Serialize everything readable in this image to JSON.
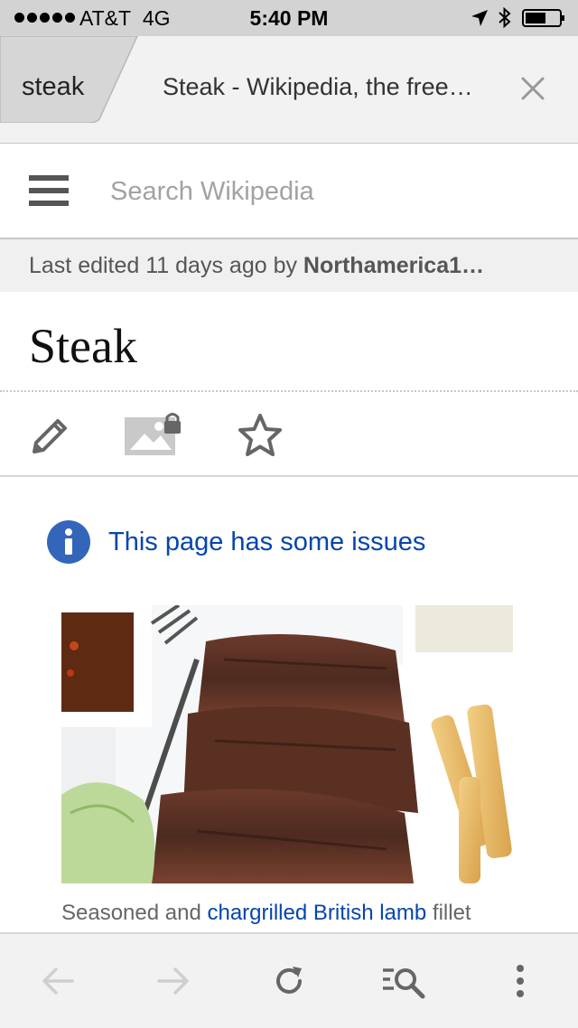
{
  "status_bar": {
    "carrier": "AT&T",
    "network": "4G",
    "time": "5:40 PM",
    "icons": [
      "signal-dots-icon",
      "location-arrow-icon",
      "bluetooth-icon",
      "battery-icon"
    ]
  },
  "tabs": {
    "inactive_label": "steak",
    "active_title": "Steak - Wikipedia, the free…",
    "close_icon": "close-icon"
  },
  "search": {
    "placeholder": "Search Wikipedia",
    "menu_icon": "hamburger-menu-icon"
  },
  "last_edited": {
    "prefix": "Last edited 11 days ago by ",
    "user": "Northamerica1…"
  },
  "article": {
    "title": "Steak",
    "actions": [
      "edit-pencil-icon",
      "locked-image-icon",
      "watch-star-icon"
    ],
    "issues_text": "This page has some issues",
    "image_alt": "steak-photo",
    "caption_pre": "Seasoned and ",
    "caption_link": "chargrilled British lamb",
    "caption_post": " fillet"
  },
  "bottom_bar": {
    "icons": [
      "back-arrow-icon",
      "forward-arrow-icon",
      "reload-icon",
      "find-in-page-icon",
      "more-vertical-icon"
    ]
  },
  "colors": {
    "link": "#0645ad",
    "info_badge": "#3366bb",
    "chrome_bg": "#f2f2f2",
    "status_bg": "#d3d3d3"
  }
}
